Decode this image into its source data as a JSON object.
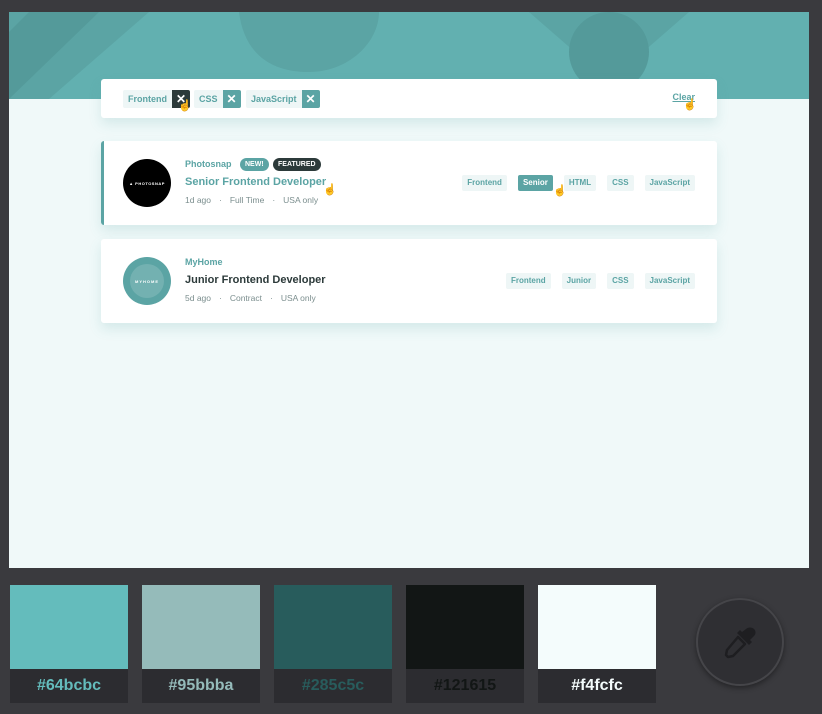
{
  "filter_bar": {
    "chips": [
      "Frontend",
      "CSS",
      "JavaScript"
    ],
    "remove_glyph": "✕",
    "clear_label": "Clear"
  },
  "jobs": [
    {
      "company": "Photosnap",
      "logo_text": "▲ PHOTOSNAP",
      "badges": [
        "NEW!",
        "FEATURED"
      ],
      "position": "Senior Frontend Developer",
      "posted": "1d ago",
      "contract": "Full Time",
      "location": "USA only",
      "tags": [
        "Frontend",
        "Senior",
        "HTML",
        "CSS",
        "JavaScript"
      ]
    },
    {
      "company": "MyHome",
      "logo_text": "MYHOME",
      "position": "Junior Frontend Developer",
      "posted": "5d ago",
      "contract": "Contract",
      "location": "USA only",
      "tags": [
        "Frontend",
        "Junior",
        "CSS",
        "JavaScript"
      ]
    }
  ],
  "meta_separator": "·",
  "palette": [
    {
      "hex": "#64bcbc",
      "text_color": "#64bcbc"
    },
    {
      "hex": "#95bbba",
      "text_color": "#95bbba"
    },
    {
      "hex": "#285c5c",
      "text_color": "#285c5c"
    },
    {
      "hex": "#121615",
      "text_color": "#121615"
    },
    {
      "hex": "#f4fcfc",
      "text_color": "#f4fcfc"
    }
  ],
  "colors": {
    "accent": "#5ba4a4",
    "dark": "#2c3a3a",
    "background": "#f0f9f9",
    "app_chrome": "#3a3a3e"
  },
  "icons": {
    "eyedropper": "eyedropper-icon",
    "cursor": "pointer-hand-cursor"
  }
}
